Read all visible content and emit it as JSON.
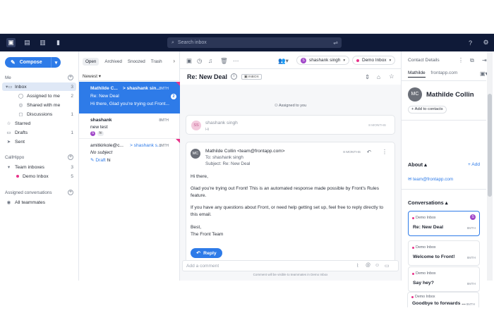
{
  "topbar": {
    "search_placeholder": "Search inbox"
  },
  "sidebar": {
    "compose_label": "Compose",
    "me_label": "Me",
    "items": [
      {
        "label": "Inbox",
        "count": "3"
      },
      {
        "label": "Assigned to me",
        "count": "2"
      },
      {
        "label": "Shared with me",
        "count": ""
      },
      {
        "label": "Discussions",
        "count": "1"
      },
      {
        "label": "Starred",
        "count": ""
      },
      {
        "label": "Drafts",
        "count": "1"
      },
      {
        "label": "Sent",
        "count": ""
      }
    ],
    "callhippo_label": "CallHippo",
    "team_inboxes_label": "Team inboxes",
    "team_inboxes_count": "3",
    "demo_inbox_label": "Demo Inbox",
    "demo_inbox_count": "5",
    "assigned_conversations_label": "Assigned conversations",
    "all_teammates_label": "All teammates"
  },
  "list": {
    "tabs": [
      "Open",
      "Archived",
      "Snoozed",
      "Trash"
    ],
    "sort_label": "Newest",
    "conversations": [
      {
        "from": "Mathilde C...",
        "to": "> shashank sin...",
        "time": "8MTH",
        "subject": "Re: New Deal",
        "snippet": "Hi there, Glad you're trying out Front...",
        "badge": "2"
      },
      {
        "from": "shashank",
        "time": "8MTH",
        "subject": "new test",
        "avatar": "S",
        "tag": "hi"
      },
      {
        "from": "amitkirkole@c...",
        "to": "> shashank s...",
        "time": "8MTH",
        "subject": "No subject",
        "draft_label": "Draft",
        "snippet": "hi"
      }
    ]
  },
  "main": {
    "assignee": "shashank singh",
    "assignee_initial": "S",
    "inbox_label": "Demo Inbox",
    "subject": "Re: New Deal",
    "inbox_tag": "INBOX",
    "assigned_note": "Assigned to you",
    "collapsed_message": {
      "initials": "SS",
      "from": "shashank singh",
      "snippet": "Hi",
      "time": "8 MONTHS"
    },
    "message": {
      "initials": "MC",
      "from": "Mathilde Collin <team@frontapp.com>",
      "to": "To: shashank singh",
      "subject": "Subject: Re: New Deal",
      "time": "8 MONTHS",
      "greeting": "Hi there,",
      "para1": "Glad you're trying out Front! This is an automated response made possible by Front's Rules feature.",
      "para2": "If you have any questions about Front, or need help getting set up, feel free to reply directly to this email.",
      "signoff": "Best,",
      "signature": "The Front Team"
    },
    "reply_label": "Reply",
    "comment_placeholder": "Add a comment",
    "comment_note": "Comment will be visible to teammates in Demo Inbox"
  },
  "right": {
    "title": "Contact Details",
    "tabs": [
      "Mathilde",
      "frontapp.com"
    ],
    "initials": "MC",
    "name": "Mathilde Collin",
    "add_contact_label": "+ Add to contacts",
    "about_label": "About",
    "add_label": "+ Add",
    "email": "team@frontapp.com",
    "conversations_label": "Conversations",
    "cards": [
      {
        "inbox": "Demo Inbox",
        "title": "Re: New Deal",
        "time": "8MTH",
        "avatar": "S"
      },
      {
        "inbox": "Demo Inbox",
        "title": "Welcome to Front!",
        "time": "8MTH"
      },
      {
        "inbox": "Demo Inbox",
        "title": "Say hey?",
        "time": "8MTH"
      },
      {
        "inbox": "Demo Inbox",
        "title": "Goodbye to forwards ...",
        "time": "8MTH"
      }
    ]
  },
  "colors": {
    "accent": "#2e7be8",
    "topbar": "#0f1a38",
    "inbox_dot": "#e8338a"
  }
}
